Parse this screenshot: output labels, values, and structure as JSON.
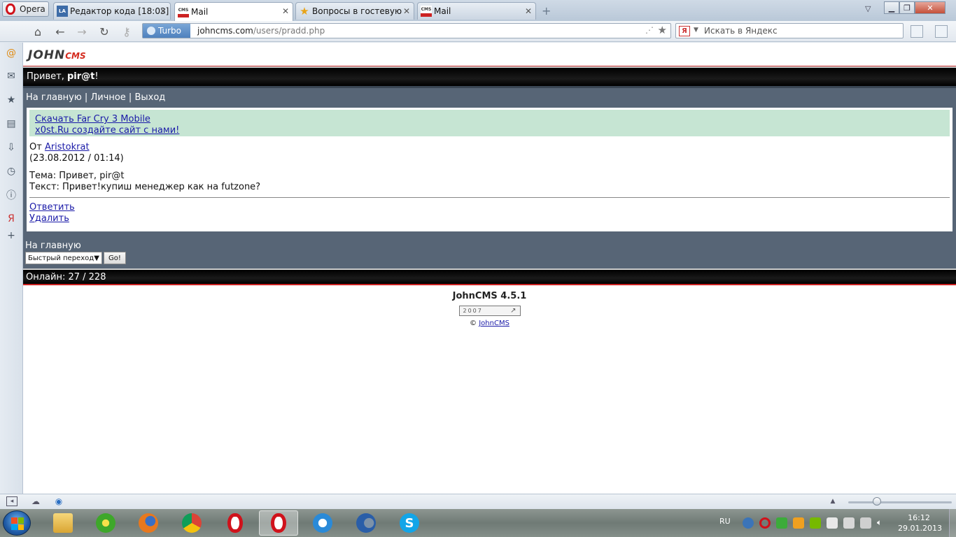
{
  "browser": {
    "menu_label": "Opera",
    "tabs": [
      {
        "title": "Редактор кода [18:03]",
        "favicon": "editor-favicon",
        "active": false
      },
      {
        "title": "Mail",
        "favicon": "johncms-favicon",
        "active": true
      },
      {
        "title": "Вопросы в гостевую",
        "favicon": "star-favicon",
        "active": false
      },
      {
        "title": "Mail",
        "favicon": "johncms-favicon",
        "active": false
      }
    ],
    "turbo_label": "Turbo",
    "url_host": "johncms.com",
    "url_path": "/users/pradd.php",
    "search_placeholder": "Искать в Яндекс",
    "search_engine_icon": "Я"
  },
  "page": {
    "logo_main": "JOHN",
    "logo_suffix": "CMS",
    "greeting_prefix": "Привет, ",
    "greeting_user": "pir@t",
    "greeting_suffix": "!",
    "menu": {
      "home": "На главную",
      "personal": "Личное",
      "logout": "Выход",
      "separator": " | "
    },
    "ads": [
      "Скачать Far Cry 3 Mobile",
      "x0st.Ru создайте сайт с нами!"
    ],
    "message": {
      "from_label": "От ",
      "from_user": "Aristokrat",
      "date": "(23.08.2012 / 01:14)",
      "subject_line": "Тема: Привет, pir@t",
      "text_line": "Текст: Привет!купиш менеджер как на futzone?",
      "reply_link": "Ответить",
      "delete_link": "Удалить"
    },
    "footer_home": "На главную",
    "quick_jump_label": "Быстрый переход",
    "go_button": "Go!",
    "online": "Онлайн: 27 / 228",
    "version": "JohnCMS 4.5.1",
    "counter_text": "2007",
    "copyright_symbol": "© ",
    "copyright_link": "JohnCMS"
  },
  "taskbar": {
    "language": "RU",
    "time": "16:12",
    "date": "29.01.2013"
  },
  "colors": {
    "menu_bar": "#576576",
    "ads_bg": "#c6e5d3",
    "link": "#1a1aa8",
    "accent_red": "#cc2222"
  }
}
